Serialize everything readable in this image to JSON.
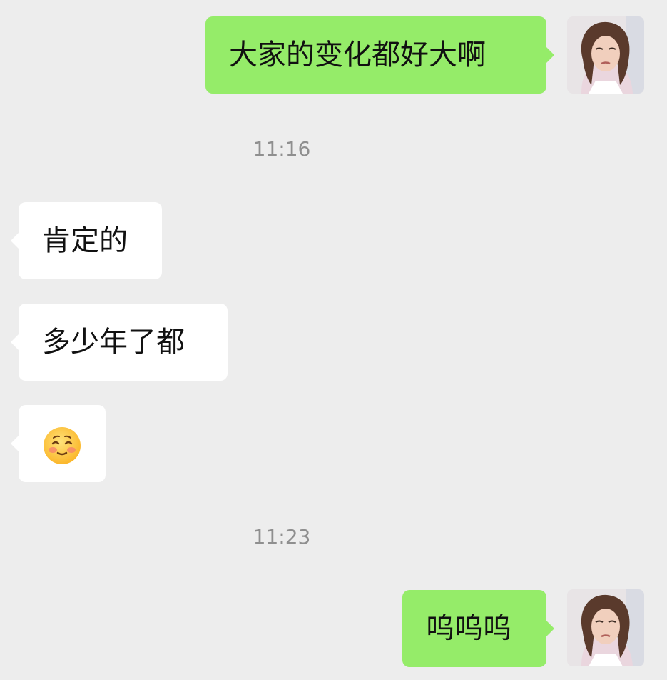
{
  "messages": [
    {
      "type": "sent",
      "text": "大家的变化都好大啊"
    },
    {
      "type": "time",
      "text": "11:16"
    },
    {
      "type": "received",
      "text": "肯定的"
    },
    {
      "type": "received",
      "text": "多少年了都"
    },
    {
      "type": "received",
      "emoji": "smiling-blushing-face-emoji"
    },
    {
      "type": "time",
      "text": "11:23"
    },
    {
      "type": "sent",
      "text": "呜呜呜"
    }
  ],
  "colors": {
    "background": "#ededed",
    "sent_bubble": "#95ec69",
    "received_bubble": "#ffffff",
    "timestamp": "#8f8f8f"
  }
}
